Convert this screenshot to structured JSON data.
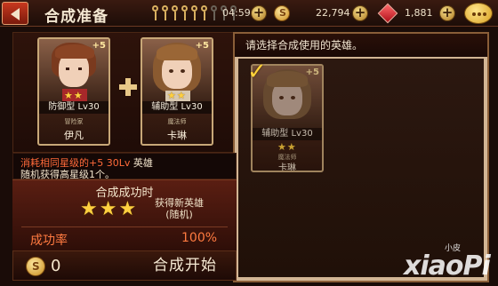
{
  "header": {
    "title": "合成准备",
    "keys_total": 9,
    "keys_active": 6,
    "timer": "04:59",
    "gold": "22,794",
    "gems": "1,881"
  },
  "materials": [
    {
      "plus": "+5",
      "stars": 2,
      "type_level": "防御型 Lv30",
      "class_name": "冒险家",
      "name": "伊凡"
    },
    {
      "plus": "+5",
      "stars": 2,
      "type_level": "辅助型 Lv30",
      "class_name": "魔法师",
      "name": "卡琳"
    }
  ],
  "right_panel": {
    "header": "请选择合成使用的英雄。",
    "selected": {
      "plus": "+5",
      "stars": 2,
      "type_level": "辅助型 Lv30",
      "class_name": "魔法师",
      "name": "卡琳"
    }
  },
  "info": {
    "line1_highlight": "消耗相同星级的+5 30Lv",
    "line1_rest": " 英雄",
    "line2": "随机获得高星级1个。"
  },
  "success": {
    "title": "合成成功时",
    "stars": 3,
    "result_line1": "获得新英雄",
    "result_line2": "(随机)",
    "rate_label": "成功率",
    "rate_value": "100%"
  },
  "footer": {
    "cost": "0",
    "start_label": "合成开始"
  },
  "watermark": {
    "text": "xiaoPi",
    "small": "小皮"
  },
  "colors": {
    "highlight": "#ff6a3a",
    "star": "#ffd040",
    "rate": "#ff7a40"
  }
}
